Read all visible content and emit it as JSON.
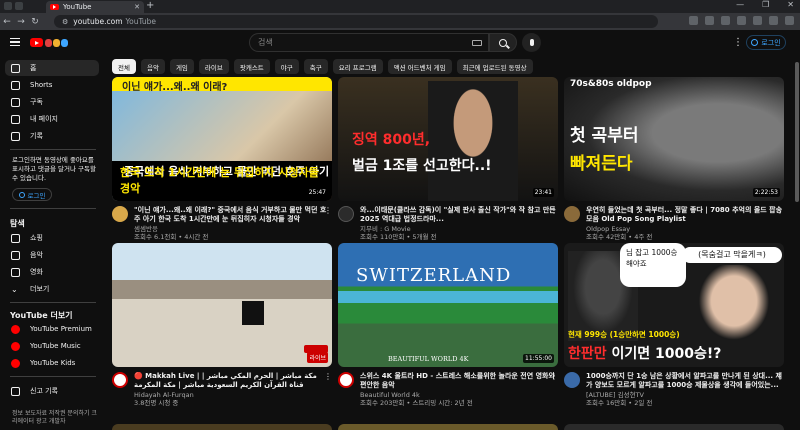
{
  "browser": {
    "tab_title": "YouTube",
    "tab_close": "✕",
    "new_tab": "+",
    "url": "youtube.com",
    "url_suffix": "YouTube",
    "win_min": "—",
    "win_max": "❐",
    "win_close": "✕",
    "nav_back": "←",
    "nav_fwd": "→",
    "nav_reload": "↻"
  },
  "header": {
    "search_placeholder": "검색",
    "login_label": "로그인",
    "kebab": "⋮",
    "doodle_colors": [
      "#e04040",
      "#f0b030",
      "#3ea6ff"
    ]
  },
  "sidebar": {
    "items": [
      {
        "label": "홈",
        "icon": "home-icon"
      },
      {
        "label": "Shorts",
        "icon": "shorts-icon"
      },
      {
        "label": "구독",
        "icon": "subscriptions-icon"
      },
      {
        "label": "내 페이지",
        "icon": "you-icon"
      },
      {
        "label": "기록",
        "icon": "history-icon"
      }
    ],
    "login_message": "로그인하면 동영상에 좋아요를 표시하고 댓글을 달거나 구독할 수 있습니다.",
    "login_label": "로그인",
    "explore_heading": "탐색",
    "explore_items": [
      {
        "label": "쇼핑",
        "icon": "shopping-icon"
      },
      {
        "label": "음악",
        "icon": "music-icon"
      },
      {
        "label": "영화",
        "icon": "movies-icon"
      },
      {
        "label": "더보기",
        "icon": "chevron-down-icon"
      }
    ],
    "more_heading": "YouTube 더보기",
    "more_items": [
      {
        "label": "YouTube Premium"
      },
      {
        "label": "YouTube Music"
      },
      {
        "label": "YouTube Kids"
      }
    ],
    "report_label": "신고 기록",
    "footer": "정보 보도자료 저작권 문의하기 크리에이터 광고 개발자"
  },
  "chips": [
    "전체",
    "음악",
    "게임",
    "라이브",
    "팟캐스트",
    "야구",
    "축구",
    "요리 프로그램",
    "액션 어드벤처 게임",
    "최근에 업로드된 동영상"
  ],
  "videos": [
    {
      "title": "\"이닌 얘가...왜..왜 이래?\" 중국에서 음식 거부하고 물만 먹던 호주 아기 한국 도착 1시간만에 눈 뒤집히자 시청자들 경악",
      "channel": "셈셈반응",
      "stats": "조회수 6.1천회 • 4시간 전",
      "duration": "25:47",
      "thumb_top": "이닌 얘가...왜..왜 이래?",
      "thumb_line1": "중국에서 음식 거부하고 물만 먹던 호주 아기",
      "thumb_line2": "한국 도착 1시간만에 눈 뒤집히자 시청자들 경악"
    },
    {
      "title": "와...이태문(클라쓰 감독)이 \"실제 판사 출신 작가\"와 작 참고 만든 2025 역대급 법정드라마...",
      "channel": "지무비 : G Movie",
      "stats": "조회수 110만회 • 5개월 전",
      "duration": "23:41",
      "thumb_line1": "징역 800년,",
      "thumb_line2": "벌금 1조를 선고한다..!"
    },
    {
      "title": "우연히 들었는데 첫 곡부터... 정말 좋다 | 7080 추억의 올드 팝송 모음 Old Pop Song Playlist",
      "channel": "Oldpop Essay",
      "stats": "조회수 42만회 • 4주 전",
      "duration": "2:22:53",
      "thumb_top": "70s&80s oldpop",
      "thumb_line1": "첫 곡부터",
      "thumb_line2": "빠져든다"
    },
    {
      "title": "🔴 Makkah Live | مكة مباشر | الحرم المكي مباشر | قناة القرآن الكريم السعودية مباشر | مكة المكرمة",
      "channel": "Hidayah Al-Furqan",
      "stats": "3.8천명 시청 중",
      "duration": "라이브"
    },
    {
      "title": "스위스 4K 울트라 HD - 스트레스 해소를위한 놀라운 전연 영화와 편안한 음악",
      "channel": "Beautiful World 4k",
      "stats": "조회수 203만회 • 스트리밍 시간: 2년 전",
      "duration": "11:55:00",
      "thumb_line1": "SWITZERLAND",
      "thumb_line2": "BEAUTIFUL WORLD 4K"
    },
    {
      "title": "1000승까지 단 1승 남은 상황에서 알파고를 만나게 된 상대... 제가 양보도 모르게 알파고를 1000승 제물상을 생각에 들어있는...",
      "channel": "[ALTUBE] 김성현TV",
      "stats": "조회수 16만회 • 2일 전",
      "duration": "",
      "thumb_bubble1": "님 잡고 1000승 해야죠",
      "thumb_bubble2": "(목숨걸고 막을게ㅋ)",
      "thumb_line1": "현재 999승 (1승만하면 1000승)",
      "thumb_line2a": "한판만 ",
      "thumb_line2b": "이기면 1000승!?"
    }
  ]
}
